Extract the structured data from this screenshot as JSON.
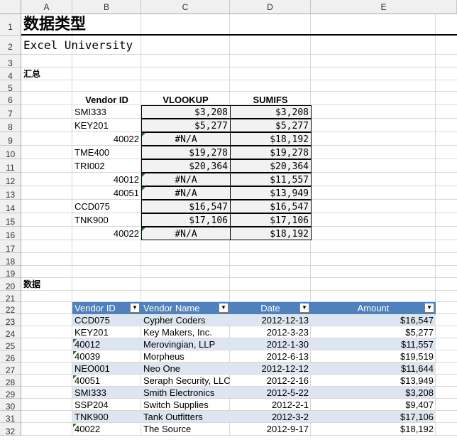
{
  "columns": [
    "A",
    "B",
    "C",
    "D",
    "E"
  ],
  "rows": [
    "1",
    "2",
    "3",
    "4",
    "5",
    "6",
    "7",
    "8",
    "9",
    "10",
    "11",
    "12",
    "13",
    "14",
    "15",
    "16",
    "17",
    "18",
    "19",
    "20",
    "21",
    "22",
    "23",
    "24",
    "25",
    "26",
    "27",
    "28",
    "29",
    "30",
    "31",
    "32"
  ],
  "title": "数据类型",
  "subtitle": "Excel University",
  "summary_label": "汇总",
  "data_label": "数据",
  "summary_table": {
    "headers": [
      "Vendor ID",
      "VLOOKUP",
      "SUMIFS"
    ],
    "rows": [
      {
        "vendor": "SMI333",
        "vlookup": "$3,208",
        "sumifs": "$3,208",
        "numeric_id": false
      },
      {
        "vendor": "KEY201",
        "vlookup": "$5,277",
        "sumifs": "$5,277",
        "numeric_id": false
      },
      {
        "vendor": "40022",
        "vlookup": "#N/A",
        "sumifs": "$18,192",
        "numeric_id": true
      },
      {
        "vendor": "TME400",
        "vlookup": "$19,278",
        "sumifs": "$19,278",
        "numeric_id": false
      },
      {
        "vendor": "TRI002",
        "vlookup": "$20,364",
        "sumifs": "$20,364",
        "numeric_id": false
      },
      {
        "vendor": "40012",
        "vlookup": "#N/A",
        "sumifs": "$11,557",
        "numeric_id": true
      },
      {
        "vendor": "40051",
        "vlookup": "#N/A",
        "sumifs": "$13,949",
        "numeric_id": true
      },
      {
        "vendor": "CCD075",
        "vlookup": "$16,547",
        "sumifs": "$16,547",
        "numeric_id": false
      },
      {
        "vendor": "TNK900",
        "vlookup": "$17,106",
        "sumifs": "$17,106",
        "numeric_id": false
      },
      {
        "vendor": "40022",
        "vlookup": "#N/A",
        "sumifs": "$18,192",
        "numeric_id": true
      }
    ]
  },
  "data_table": {
    "headers": [
      "Vendor ID",
      "Vendor Name",
      "Date",
      "Amount"
    ],
    "dropdown_icon": "dropdown-arrow-icon",
    "header_color": "#4f81bd",
    "stripe_color": "#dce6f1",
    "rows": [
      {
        "id": "CCD075",
        "name": "Cypher Coders",
        "date": "2012-12-13",
        "amount": "$16,547",
        "text_number": false
      },
      {
        "id": "KEY201",
        "name": "Key Makers, Inc.",
        "date": "2012-3-23",
        "amount": "$5,277",
        "text_number": false
      },
      {
        "id": "40012",
        "name": "Merovingian, LLP",
        "date": "2012-1-30",
        "amount": "$11,557",
        "text_number": true
      },
      {
        "id": "40039",
        "name": "Morpheus",
        "date": "2012-6-13",
        "amount": "$19,519",
        "text_number": true
      },
      {
        "id": "NEO001",
        "name": "Neo One",
        "date": "2012-12-12",
        "amount": "$11,644",
        "text_number": false
      },
      {
        "id": "40051",
        "name": "Seraph Security, LLC",
        "date": "2012-2-16",
        "amount": "$13,949",
        "text_number": true
      },
      {
        "id": "SMI333",
        "name": "Smith Electronics",
        "date": "2012-5-22",
        "amount": "$3,208",
        "text_number": false
      },
      {
        "id": "SSP204",
        "name": "Switch Supplies",
        "date": "2012-2-1",
        "amount": "$9,407",
        "text_number": false
      },
      {
        "id": "TNK900",
        "name": "Tank Outfitters",
        "date": "2012-3-2",
        "amount": "$17,106",
        "text_number": false
      },
      {
        "id": "40022",
        "name": "The Source",
        "date": "2012-9-17",
        "amount": "$18,192",
        "text_number": true
      }
    ]
  }
}
